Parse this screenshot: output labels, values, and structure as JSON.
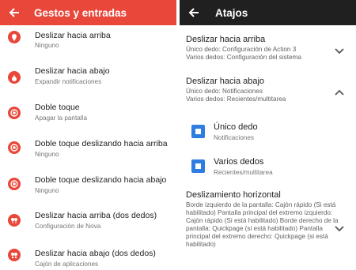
{
  "left": {
    "title": "Gestos y entradas",
    "items": [
      {
        "title": "Deslizar hacia arriba",
        "subtitle": "Ninguno",
        "icon": "location-pin-icon"
      },
      {
        "title": "Deslizar hacia abajo",
        "subtitle": "Expandir notificaciones",
        "icon": "touch-down-icon"
      },
      {
        "title": "Doble toque",
        "subtitle": "Apagar la pantalla",
        "icon": "double-tap-icon"
      },
      {
        "title": "Doble toque deslizando hacia arriba",
        "subtitle": "Ninguno",
        "icon": "double-tap-icon"
      },
      {
        "title": "Doble toque deslizando hacia abajo",
        "subtitle": "Ninguno",
        "icon": "double-tap-icon"
      },
      {
        "title": "Deslizar hacia arriba (dos dedos)",
        "subtitle": "Configuración de Nova",
        "icon": "two-finger-icon"
      },
      {
        "title": "Deslizar hacia abajo (dos dedos)",
        "subtitle": "Cajón de aplicaciones",
        "icon": "two-finger-icon"
      }
    ]
  },
  "right": {
    "title": "Atajos",
    "sections": [
      {
        "title": "Deslizar hacia arriba",
        "lines": [
          "Único dedo: Configuración de Action 3",
          "Varios dedos: Configuración del sistema"
        ],
        "expanded": false
      },
      {
        "title": "Deslizar hacia abajo",
        "lines": [
          "Único dedo: Notificaciones",
          "Varios dedos: Recientes/multitarea"
        ],
        "expanded": true
      }
    ],
    "sub_items": [
      {
        "title": "Único dedo",
        "subtitle": "Notificaciones"
      },
      {
        "title": "Varios dedos",
        "subtitle": "Recientes/multitarea"
      }
    ],
    "horizontal": {
      "title": "Deslizamiento horizontal",
      "text": "Borde izquierdo de la pantalla: Cajón rápido (Si está habilitado) Pantalla principal del extremo izquierdo: Cajón rápido (Si está habilitado) Borde derecho de la pantalla: Quickpage (si está habilitado) Pantalla principal del extremo derecho: Quickpage (si está habilitado)"
    }
  },
  "colors": {
    "left_bar": "#e8473a",
    "right_bar": "#202020",
    "accent_blue": "#2f7de1"
  }
}
